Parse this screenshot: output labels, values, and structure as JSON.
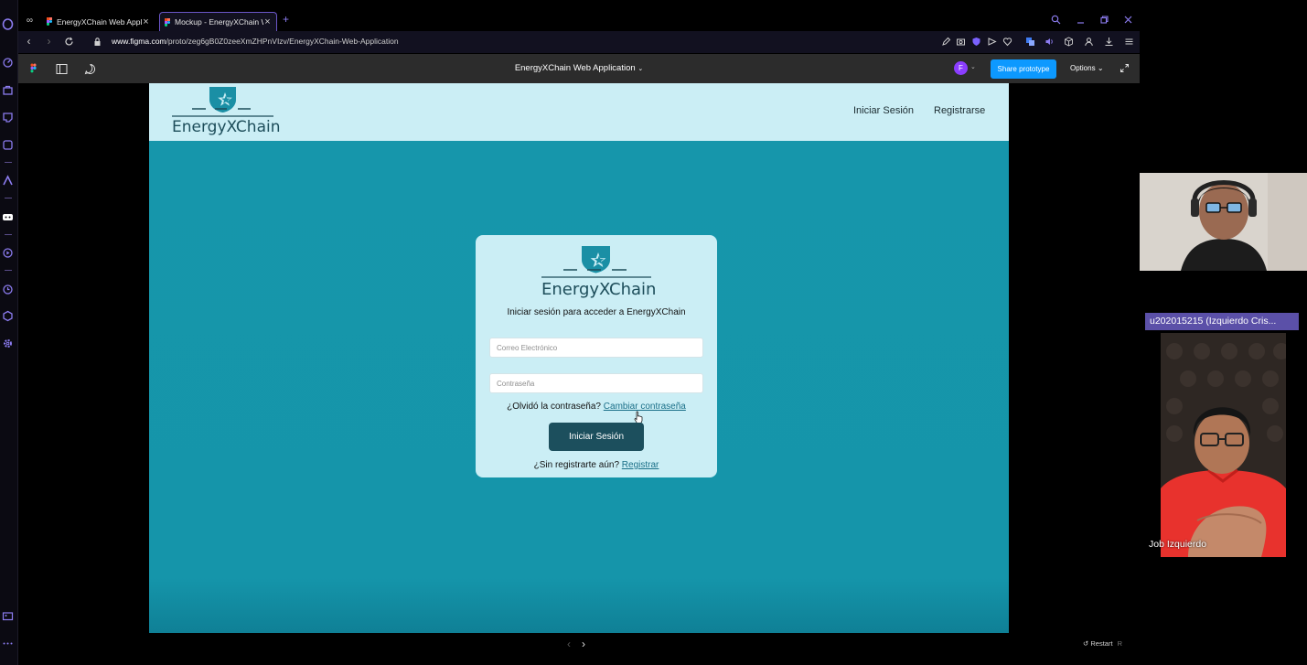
{
  "browser": {
    "tabs": [
      {
        "title": "EnergyXChain Web Applica",
        "active": false
      },
      {
        "title": "Mockup - EnergyXChain W",
        "active": true
      }
    ],
    "new_tab_label": "+",
    "url_host": "www.figma.com",
    "url_path": "/proto/zeg6gB0Z0zeeXmZHPnVIzv/EnergyXChain-Web-Application"
  },
  "figma": {
    "file_title": "EnergyXChain Web Application",
    "avatar_initial": "F",
    "share_label": "Share prototype",
    "options_label": "Options",
    "restart_label": "Restart",
    "restart_shortcut": "R"
  },
  "app": {
    "brand": "EnergyXChain",
    "nav_login": "Iniciar Sesión",
    "nav_register": "Registrarse",
    "card": {
      "subtitle": "Iniciar sesión para acceder a EnergyXChain",
      "email_placeholder": "Correo Electrónico",
      "password_placeholder": "Contraseña",
      "forgot_text": "¿Olvidó la contraseña?",
      "forgot_link": "Cambiar contraseña",
      "login_button": "Iniciar Sesión",
      "no_account_text": "¿Sin registrarte aún?",
      "register_link": "Registrar"
    },
    "colors": {
      "canvas": "#1696ab",
      "header": "#cbeef5",
      "card": "#cbeef5",
      "primary_button": "#1c4f5d",
      "logo_teal": "#1a8fa5"
    }
  },
  "meeting": {
    "participant_badge": "u202015215 (Izquierdo Cris...",
    "participant_name": "Job Izquierdo"
  }
}
